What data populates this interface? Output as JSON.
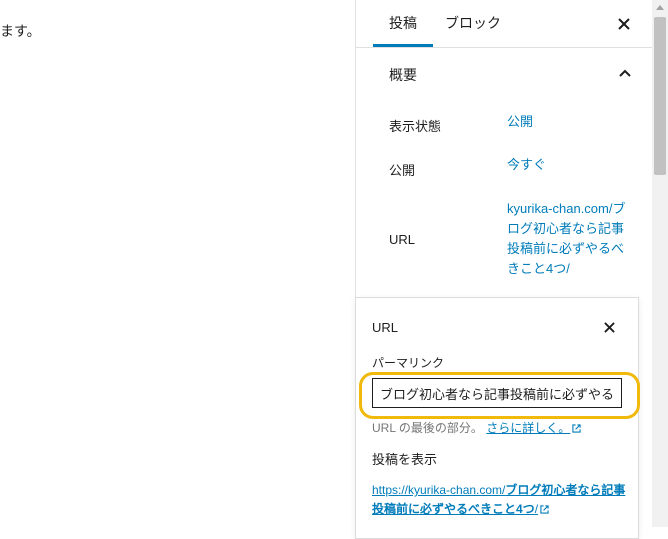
{
  "editor": {
    "body_text": "ます。"
  },
  "sidebar": {
    "tabs": [
      {
        "label": "投稿",
        "active": true
      },
      {
        "label": "ブロック",
        "active": false
      }
    ],
    "close_icon": "close-icon",
    "summary": {
      "title": "概要",
      "rows": [
        {
          "label": "表示状態",
          "value": "公開"
        },
        {
          "label": "公開",
          "value": "今すぐ"
        },
        {
          "label": "URL",
          "value": "kyurika-chan.com/ブログ初心者なら記事投稿前に必ずやるべきこと4つ/"
        }
      ]
    }
  },
  "url_popover": {
    "title": "URL",
    "permalink_label": "パーマリンク",
    "slug_value": "ブログ初心者なら記事投稿前に必ずやるべきこと4つ",
    "help_text": "URL の最後の部分。",
    "help_link": "さらに詳しく。",
    "view_label": "投稿を表示",
    "view_link_base": "https://kyurika-chan.com/",
    "view_link_slug": "ブログ初心者なら記事投稿前に必ずやるべきこと4つ",
    "view_link_trail": "/"
  },
  "colors": {
    "accent": "#007cba",
    "highlight": "#f0b90b"
  }
}
